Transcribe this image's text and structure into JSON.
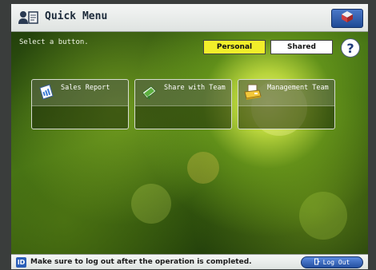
{
  "title_bar": {
    "title": "Quick Menu",
    "title_icon": "person-document-icon",
    "home_icon": "home-box-icon"
  },
  "main": {
    "instruction": "Select a button.",
    "tabs": [
      {
        "label": "Personal",
        "selected": true
      },
      {
        "label": "Shared",
        "selected": false
      }
    ],
    "help_label": "?",
    "buttons": [
      {
        "label": "Sales Report",
        "icon": "document-chart-icon"
      },
      {
        "label": "Share with Team",
        "icon": "send-document-icon"
      },
      {
        "label": "Management Team",
        "icon": "printer-documents-icon"
      }
    ]
  },
  "status_bar": {
    "info_badge": "ID",
    "message": "Make sure to log out after the operation is completed.",
    "logout_label": "Log Out",
    "logout_icon": "logout-arrow-icon"
  },
  "colors": {
    "selected_tab": "#f2ee2a",
    "unselected_tab": "#ffffff",
    "button_blue": "#2b5fb8"
  }
}
